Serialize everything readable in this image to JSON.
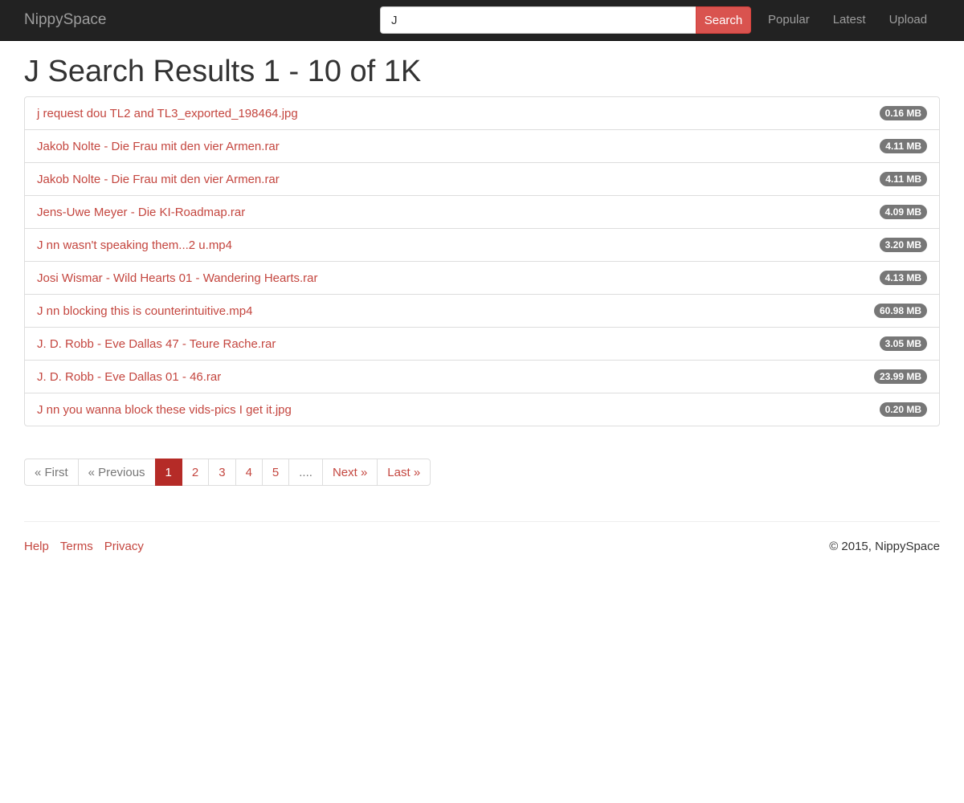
{
  "navbar": {
    "brand": "NippySpace",
    "search": {
      "value": "J",
      "button_label": "Search"
    },
    "links": [
      "Popular",
      "Latest",
      "Upload"
    ]
  },
  "page_title": "J Search Results 1 - 10 of 1K",
  "results": [
    {
      "name": "j request dou TL2 and TL3_exported_198464.jpg",
      "size": "0.16 MB"
    },
    {
      "name": "Jakob Nolte - Die Frau mit den vier Armen.rar",
      "size": "4.11 MB"
    },
    {
      "name": "Jakob Nolte - Die Frau mit den vier Armen.rar",
      "size": "4.11 MB"
    },
    {
      "name": "Jens-Uwe Meyer - Die KI-Roadmap.rar",
      "size": "4.09 MB"
    },
    {
      "name": "J nn wasn't speaking them...2 u.mp4",
      "size": "3.20 MB"
    },
    {
      "name": "Josi Wismar - Wild Hearts 01 - Wandering Hearts.rar",
      "size": "4.13 MB"
    },
    {
      "name": "J nn blocking this is counterintuitive.mp4",
      "size": "60.98 MB"
    },
    {
      "name": "J. D. Robb - Eve Dallas 47 - Teure Rache.rar",
      "size": "3.05 MB"
    },
    {
      "name": "J. D. Robb - Eve Dallas 01 - 46.rar",
      "size": "23.99 MB"
    },
    {
      "name": "J nn you wanna block these vids-pics I get it.jpg",
      "size": "0.20 MB"
    }
  ],
  "pagination": {
    "first": "« First",
    "previous": "« Previous",
    "pages": [
      "1",
      "2",
      "3",
      "4",
      "5"
    ],
    "active_page": "1",
    "ellipsis": "....",
    "next": "Next »",
    "last": "Last »"
  },
  "footer": {
    "links": [
      "Help",
      "Terms",
      "Privacy"
    ],
    "copyright": "© 2015, NippySpace"
  },
  "colors": {
    "navbar_bg": "#222222",
    "accent": "#d9534f",
    "link": "#c4463f",
    "active_page": "#b52b27",
    "badge_bg": "#777777"
  }
}
